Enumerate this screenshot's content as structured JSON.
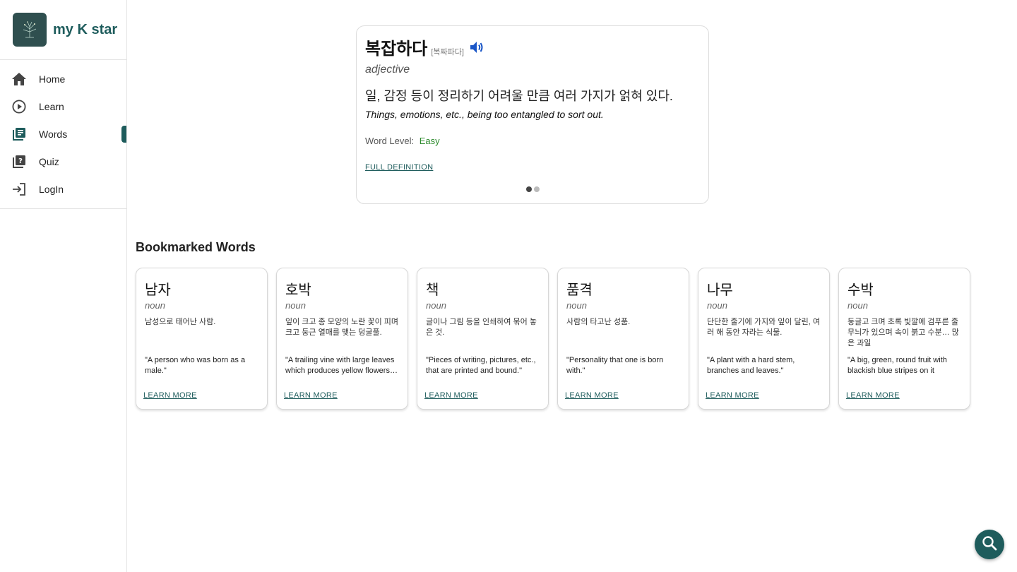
{
  "brand": {
    "name": "my K star",
    "logo_icon": "tree-logo-icon"
  },
  "nav": {
    "items": [
      {
        "label": "Home",
        "icon": "home-icon"
      },
      {
        "label": "Learn",
        "icon": "play-circle-icon"
      },
      {
        "label": "Words",
        "icon": "library-books-icon",
        "active": true
      },
      {
        "label": "Quiz",
        "icon": "quiz-icon"
      },
      {
        "label": "LogIn",
        "icon": "login-icon"
      }
    ]
  },
  "featured": {
    "word": "복잡하다",
    "pronunciation": "[복짜파다]",
    "pos": "adjective",
    "definition_ko": "일, 감정 등이 정리하기 어려울 만큼 여러 가지가 얽혀 있다.",
    "definition_en": "Things, emotions, etc., being too entangled to sort out.",
    "level_label": "Word Level:",
    "level_value": "Easy",
    "full_definition_label": "FULL DEFINITION",
    "carousel_index": 0,
    "carousel_count": 2
  },
  "bookmarked": {
    "title": "Bookmarked Words",
    "learn_more_label": "LEARN MORE",
    "cards": [
      {
        "word": "남자",
        "pos": "noun",
        "ko": "남성으로 태어난 사람.",
        "en": "\"A person who was born as a male.\""
      },
      {
        "word": "호박",
        "pos": "noun",
        "ko": "잎이 크고 종 모양의 노란 꽃이 피며 크고 둥근 열매를 맺는 덩굴풀.",
        "en": "\"A trailing vine with large leaves which produces yellow flowers…"
      },
      {
        "word": "책",
        "pos": "noun",
        "ko": "글이나 그림 등을 인쇄하여 묶어 놓은 것.",
        "en": "\"Pieces of writing, pictures, etc., that are printed and bound.\""
      },
      {
        "word": "품격",
        "pos": "noun",
        "ko": "사람의 타고난 성품.",
        "en": "\"Personality that one is born with.\""
      },
      {
        "word": "나무",
        "pos": "noun",
        "ko": "단단한 줄기에 가지와 잎이 달린, 여러 해 동안 자라는 식물.",
        "en": "\"A plant with a hard stem, branches and leaves.\""
      },
      {
        "word": "수박",
        "pos": "noun",
        "ko": "둥글고 크며 초록 빛깔에 검푸른 줄무늬가 있으며 속이 붉고 수분… 많은 과일",
        "en": "\"A big, green, round fruit with blackish blue stripes on it which…"
      }
    ]
  },
  "fab": {
    "icon": "search-icon"
  },
  "colors": {
    "accent": "#1e5c5c",
    "easy": "#2e8b2e",
    "speaker": "#1a56c7"
  }
}
